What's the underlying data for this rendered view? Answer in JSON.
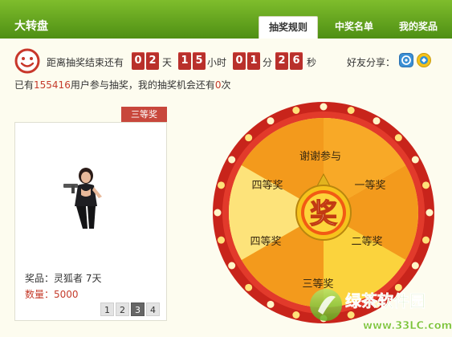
{
  "app": {
    "title": "大转盘"
  },
  "tabs": [
    {
      "label": "抽奖规则",
      "active": true
    },
    {
      "label": "中奖名单",
      "active": false
    },
    {
      "label": "我的奖品",
      "active": false
    }
  ],
  "countdown": {
    "label": "距离抽奖结束还有",
    "days": [
      "0",
      "2"
    ],
    "hours": [
      "1",
      "5"
    ],
    "minutes": [
      "0",
      "1"
    ],
    "seconds": [
      "2",
      "6"
    ],
    "units": {
      "day": "天",
      "hour": "小时",
      "minute": "分",
      "second": "秒"
    }
  },
  "share": {
    "label": "好友分享：",
    "icons": [
      "blue-share-icon",
      "round-share-icon"
    ]
  },
  "stats": {
    "prefix": "已有",
    "participants": "155416",
    "middle": "用户参与抽奖，我的抽奖机会还有",
    "chances": "0",
    "suffix": "次"
  },
  "prize": {
    "tag": "三等奖",
    "name_label": "奖品：",
    "name_value": "灵狐者 7天",
    "qty_label": "数量：",
    "qty_value": "5000",
    "pages": [
      "1",
      "2",
      "3",
      "4"
    ],
    "active_page": "3"
  },
  "wheel": {
    "center_label": "奖",
    "segments": [
      "谢谢参与",
      "一等奖",
      "二等奖",
      "三等奖",
      "四等奖",
      "四等奖"
    ],
    "colors": {
      "rim": "#d22a1f",
      "orange": "#f39a1c",
      "yellow": "#fbd33d",
      "light_yellow": "#fde377"
    }
  },
  "watermark": {
    "title": "绿茶软件园",
    "url": "www.33LC.com"
  }
}
